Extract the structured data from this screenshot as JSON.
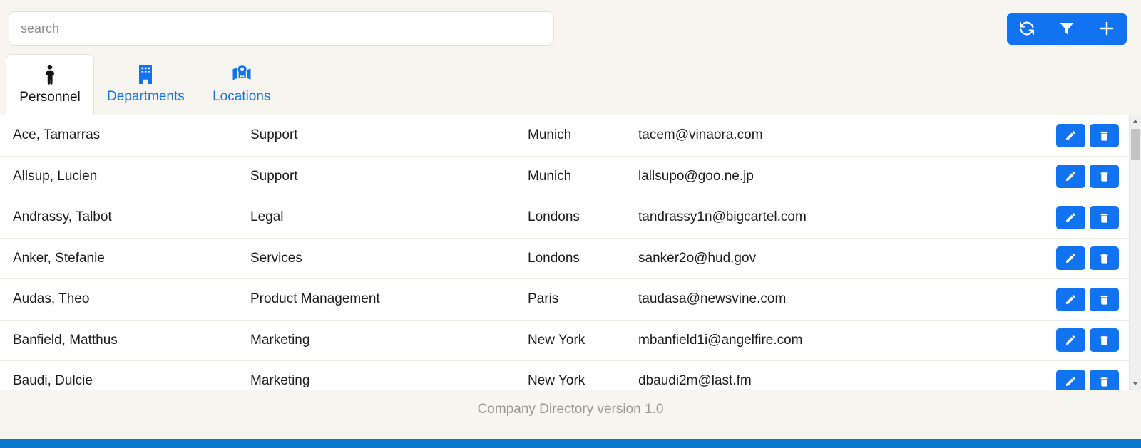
{
  "search": {
    "placeholder": "search",
    "value": ""
  },
  "toolbar": {
    "refresh_label": "refresh-icon",
    "filter_label": "filter-icon",
    "add_label": "add-icon"
  },
  "tabs": [
    {
      "label": "Personnel",
      "icon": "person-icon",
      "active": true
    },
    {
      "label": "Departments",
      "icon": "building-icon",
      "active": false
    },
    {
      "label": "Locations",
      "icon": "map-pin-icon",
      "active": false
    }
  ],
  "table": {
    "rows": [
      {
        "name": "Ace, Tamarras",
        "department": "Support",
        "location": "Munich",
        "email": "tacem@vinaora.com"
      },
      {
        "name": "Allsup, Lucien",
        "department": "Support",
        "location": "Munich",
        "email": "lallsupo@goo.ne.jp"
      },
      {
        "name": "Andrassy, Talbot",
        "department": "Legal",
        "location": "Londons",
        "email": "tandrassy1n@bigcartel.com"
      },
      {
        "name": "Anker, Stefanie",
        "department": "Services",
        "location": "Londons",
        "email": "sanker2o@hud.gov"
      },
      {
        "name": "Audas, Theo",
        "department": "Product Management",
        "location": "Paris",
        "email": "taudasa@newsvine.com"
      },
      {
        "name": "Banfield, Matthus",
        "department": "Marketing",
        "location": "New York",
        "email": "mbanfield1i@angelfire.com"
      },
      {
        "name": "Baudi, Dulcie",
        "department": "Marketing",
        "location": "New York",
        "email": "dbaudi2m@last.fm"
      }
    ],
    "row_actions": {
      "edit_label": "edit-icon",
      "delete_label": "delete-icon"
    }
  },
  "footer": {
    "text": "Company Directory version 1.0"
  },
  "colors": {
    "accent": "#1273f0",
    "bottom_bar": "#0a78cf",
    "page_background": "#f7f5ef",
    "table_background": "#ffffff",
    "footer_text": "#9a958d"
  }
}
